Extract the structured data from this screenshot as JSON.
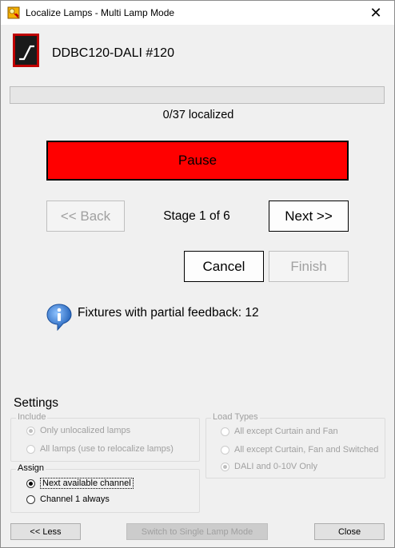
{
  "window": {
    "title": "Localize Lamps - Multi Lamp Mode",
    "close_glyph": "✕",
    "app_icon": "app-icon"
  },
  "device": {
    "icon": "ddbc-device-icon",
    "name": "DDBC120-DALI #120"
  },
  "progress": {
    "localized": 0,
    "total": 37,
    "fraction": 0,
    "label": "0/37 localized"
  },
  "controls": {
    "pause_label": "Pause",
    "back_label": "<< Back",
    "stage_label": "Stage 1 of 6",
    "next_label": "Next >>",
    "cancel_label": "Cancel",
    "finish_label": "Finish",
    "pause_color": "#ff0000"
  },
  "info": {
    "icon": "info-icon",
    "text": "Fixtures with partial feedback: 12"
  },
  "settings": {
    "title": "Settings",
    "include": {
      "legend": "Include",
      "options": [
        {
          "label": "Only unlocalized lamps",
          "selected": true
        },
        {
          "label": "All lamps (use to relocalize lamps)",
          "selected": false
        }
      ]
    },
    "load_types": {
      "legend": "Load Types",
      "options": [
        {
          "label": "All except Curtain and Fan",
          "selected": false
        },
        {
          "label": "All except Curtain, Fan and Switched",
          "selected": false
        },
        {
          "label": "DALI and 0-10V Only",
          "selected": true
        }
      ]
    },
    "assign": {
      "legend": "Assign",
      "options": [
        {
          "label": "Next available channel",
          "selected": true
        },
        {
          "label": "Channel 1 always",
          "selected": false
        }
      ]
    }
  },
  "footer": {
    "less_label": "<< Less",
    "single_mode_label": "Switch to Single Lamp Mode",
    "close_label": "Close"
  }
}
